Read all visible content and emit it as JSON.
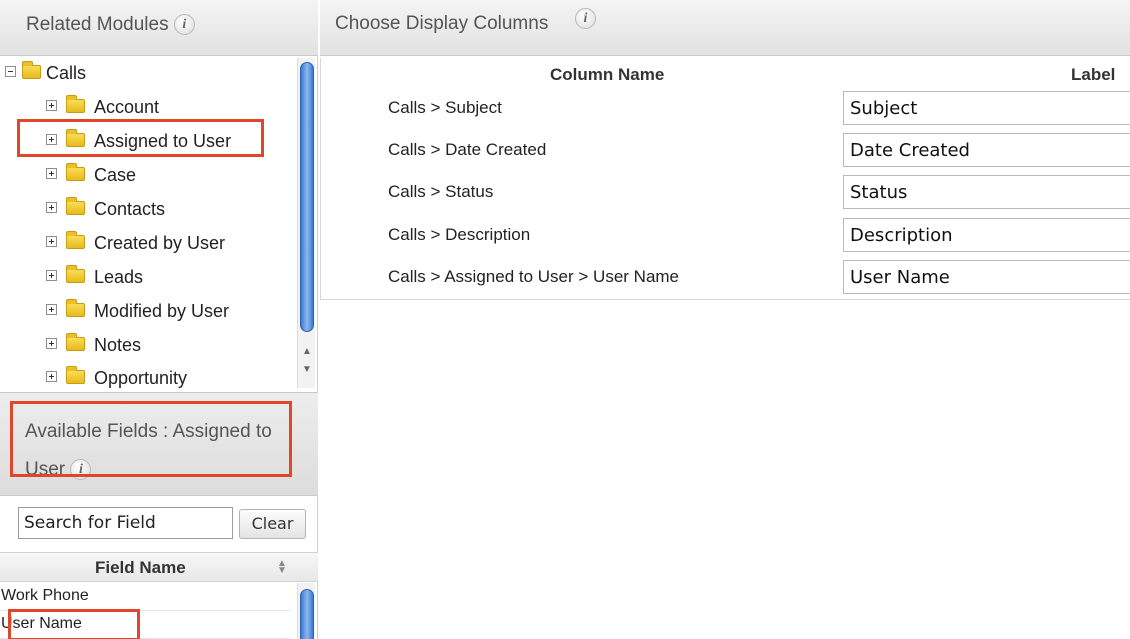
{
  "related_modules": {
    "title": "Related Modules",
    "info_glyph": "i",
    "tree": [
      {
        "label": "Calls",
        "expanded": true,
        "level": 0
      },
      {
        "label": "Account",
        "expanded": false,
        "level": 1
      },
      {
        "label": "Assigned to User",
        "expanded": false,
        "level": 1,
        "highlighted": true
      },
      {
        "label": "Case",
        "expanded": false,
        "level": 1
      },
      {
        "label": "Contacts",
        "expanded": false,
        "level": 1
      },
      {
        "label": "Created by User",
        "expanded": false,
        "level": 1
      },
      {
        "label": "Leads",
        "expanded": false,
        "level": 1
      },
      {
        "label": "Modified by User",
        "expanded": false,
        "level": 1
      },
      {
        "label": "Notes",
        "expanded": false,
        "level": 1
      },
      {
        "label": "Opportunity",
        "expanded": false,
        "level": 1
      }
    ]
  },
  "available_fields": {
    "title": "Available Fields : Assigned to User",
    "info_glyph": "i",
    "search": {
      "value": "Search for Field",
      "clear_label": "Clear"
    },
    "column_header": "Field Name",
    "rows": [
      {
        "label": "Work Phone"
      },
      {
        "label": "User Name",
        "highlighted": true
      }
    ]
  },
  "display_columns": {
    "title": "Choose Display Columns",
    "info_glyph": "i",
    "headers": {
      "column_name": "Column Name",
      "label": "Label"
    },
    "rows": [
      {
        "column": "Calls > Subject",
        "label": "Subject"
      },
      {
        "column": "Calls > Date Created",
        "label": "Date Created"
      },
      {
        "column": "Calls > Status",
        "label": "Status"
      },
      {
        "column": "Calls > Description",
        "label": "Description"
      },
      {
        "column": "Calls > Assigned to User > User Name",
        "label": "User Name"
      }
    ]
  },
  "colors": {
    "highlight": "#e1462d",
    "scroll_thumb": "#3b79cf"
  }
}
